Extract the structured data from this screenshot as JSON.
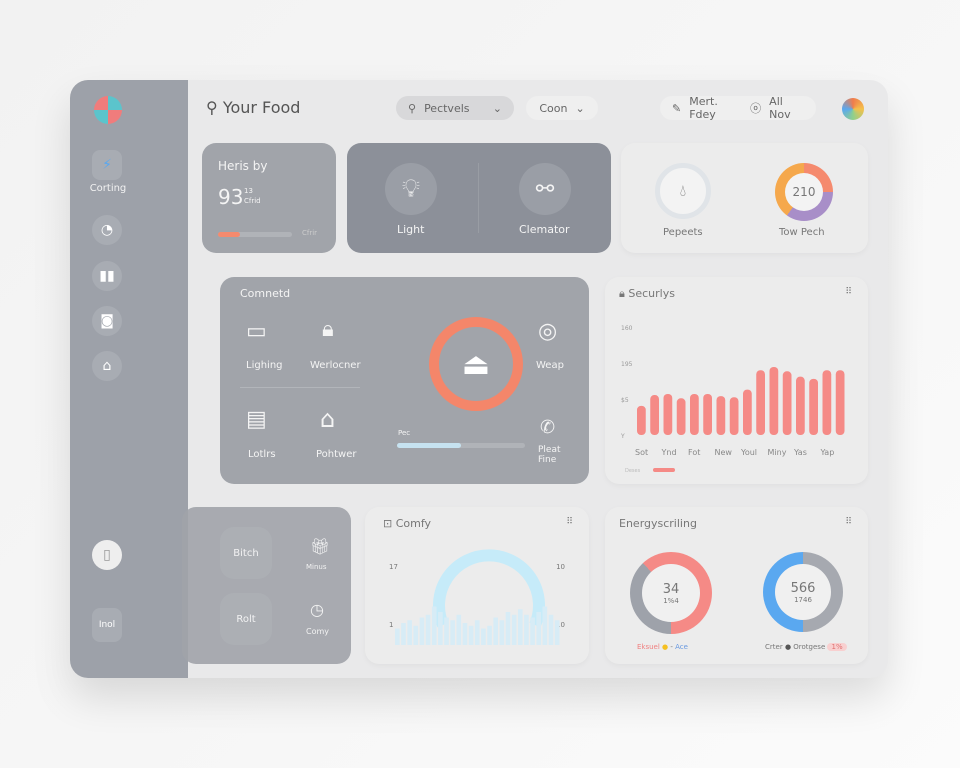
{
  "header": {
    "search_text": "Your Food",
    "filter1": "Pectvels",
    "filter2": "Coon",
    "action1": "Mert. Fdey",
    "action2": "All Nov"
  },
  "sidebar": {
    "items": [
      {
        "label": "Corting",
        "icon": "lightning-icon"
      },
      {
        "label": "",
        "icon": "gauge-icon"
      },
      {
        "label": "",
        "icon": "pause-icon"
      },
      {
        "label": "",
        "icon": "camera-icon"
      },
      {
        "label": "",
        "icon": "door-icon"
      }
    ],
    "bottom_label": "Inol"
  },
  "cards": {
    "heris": {
      "title": "Heris by",
      "value": "93",
      "unit_top": "13",
      "unit_bottom": "Cfrid",
      "bar_label": "Cfrir",
      "progress": 0.3
    },
    "devices": {
      "items": [
        {
          "label": "Light",
          "icon": "lightbulb-icon"
        },
        {
          "label": "Clemator",
          "icon": "plug-icon"
        }
      ]
    },
    "stats": {
      "items": [
        {
          "label": "Pepeets",
          "icon": "drop-icon"
        },
        {
          "label": "Tow Pech",
          "value": "210"
        }
      ]
    },
    "connected": {
      "title": "Comnetd",
      "items": [
        {
          "label": "Lighing",
          "icon": "tv-icon"
        },
        {
          "label": "Werlocner",
          "icon": "lock-icon"
        },
        {
          "label": "Lotlrs",
          "icon": "panel-icon"
        },
        {
          "label": "Pohtwer",
          "icon": "house-icon"
        }
      ],
      "right": [
        {
          "label": "Weap",
          "icon": "target-icon"
        },
        {
          "label": "Pleat Fine",
          "icon": "phone-icon"
        }
      ],
      "slider_label": "Pec",
      "slider_value": 0.5,
      "accent": "#f4866a"
    },
    "quick": {
      "items": [
        "Bitch",
        "Rolt"
      ],
      "icons": [
        {
          "label": "Minus",
          "icon": "gift-icon"
        },
        {
          "label": "Comy",
          "icon": "clock-icon"
        }
      ]
    },
    "comfy": {
      "title": "Comfy",
      "ytl": "17",
      "ytr": "10",
      "ybl": "1",
      "ybr": "10",
      "bars": [
        30,
        40,
        45,
        35,
        50,
        55,
        70,
        60,
        50,
        45,
        55,
        40,
        35,
        45,
        30,
        35,
        50,
        45,
        60,
        55,
        65,
        55,
        50,
        60,
        70,
        55,
        45
      ]
    },
    "energy": {
      "title": "Energyscriling",
      "d1_value": "34",
      "d1_sub": "1%4",
      "d1_fraction": 0.62,
      "d2_value": "566",
      "d2_sub": "1746",
      "d2_fraction": 0.5,
      "legend": [
        "Eksuel",
        "Ace",
        "Crter",
        "Orotgese",
        "1%"
      ]
    }
  },
  "chart_data": {
    "type": "bar",
    "title": "Securlys",
    "categories": [
      "Sot",
      "",
      "Ynd",
      "",
      "Fot",
      "",
      "New",
      "",
      "Youl",
      "",
      "Miny",
      "",
      "Yas",
      "",
      "Yap",
      ""
    ],
    "ytick_labels": [
      "Y",
      "$5",
      "195",
      "160"
    ],
    "values": [
      27,
      37,
      38,
      34,
      38,
      38,
      36,
      35,
      42,
      60,
      63,
      59,
      54,
      52,
      60,
      60
    ],
    "ylim": [
      0,
      100
    ],
    "legend": [
      "Deses"
    ],
    "color": "#f58a86"
  }
}
